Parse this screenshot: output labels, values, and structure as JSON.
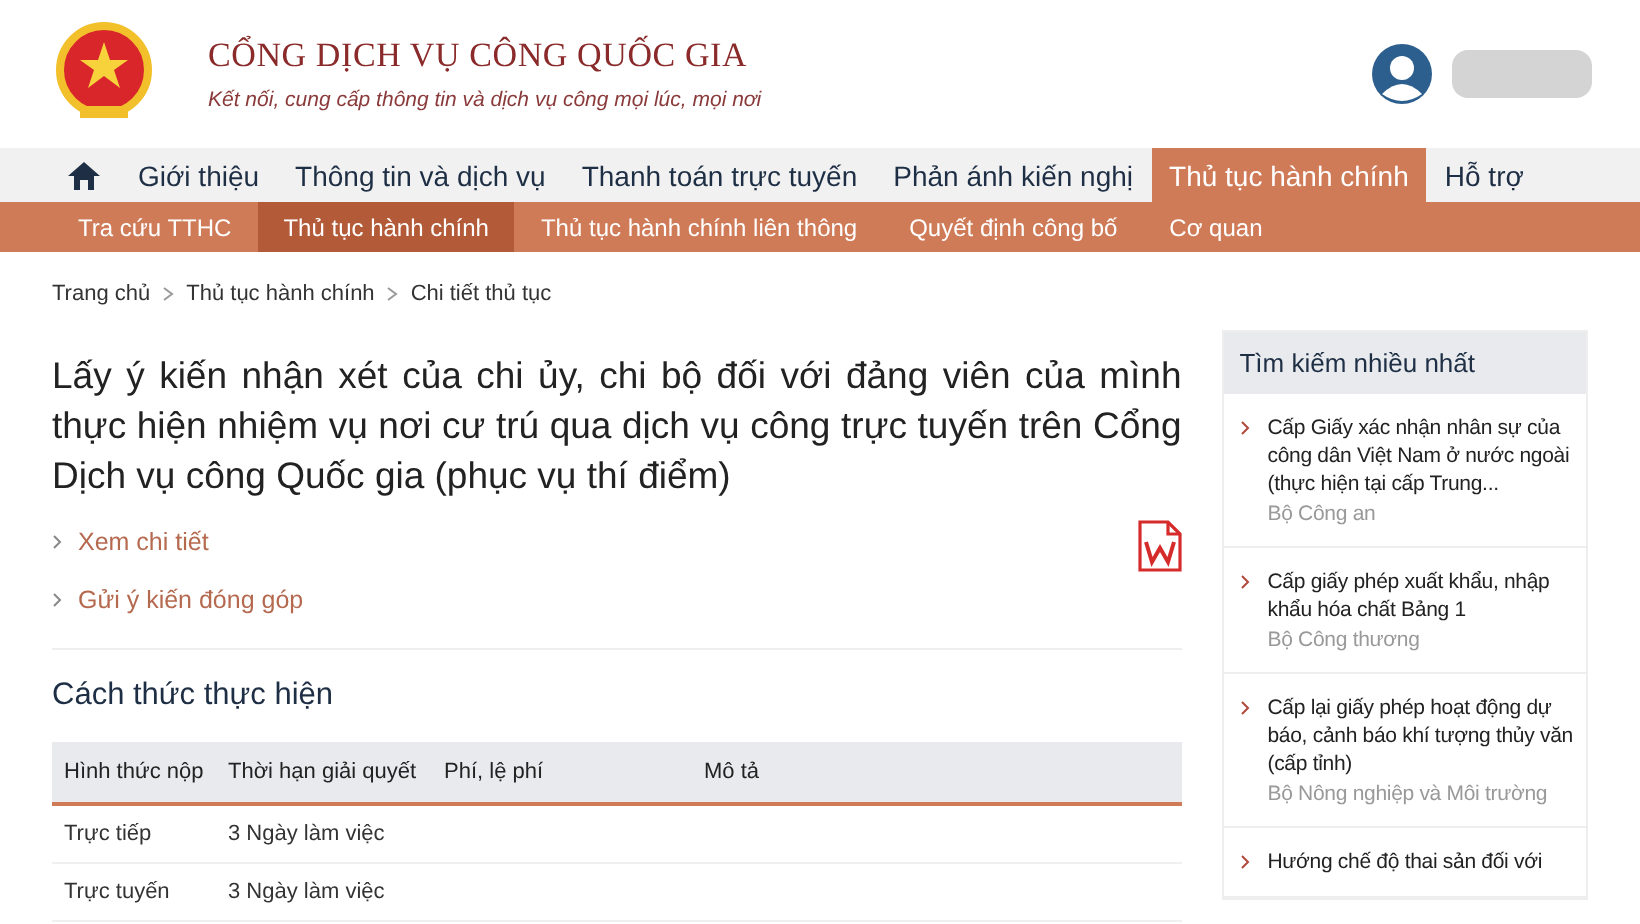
{
  "header": {
    "site_title": "CỔNG DỊCH VỤ CÔNG QUỐC GIA",
    "tagline": "Kết nối, cung cấp thông tin và dịch vụ công mọi lúc, mọi nơi"
  },
  "main_nav": [
    {
      "label": "Giới thiệu",
      "selected": false
    },
    {
      "label": "Thông tin và dịch vụ",
      "selected": false
    },
    {
      "label": "Thanh toán trực tuyến",
      "selected": false
    },
    {
      "label": "Phản ánh kiến nghị",
      "selected": false
    },
    {
      "label": "Thủ tục hành chính",
      "selected": true
    },
    {
      "label": "Hỗ trợ",
      "selected": false
    }
  ],
  "sub_nav": [
    {
      "label": "Tra cứu TTHC",
      "selected": false
    },
    {
      "label": "Thủ tục hành chính",
      "selected": true
    },
    {
      "label": "Thủ tục hành chính liên thông",
      "selected": false
    },
    {
      "label": "Quyết định công bố",
      "selected": false
    },
    {
      "label": "Cơ quan",
      "selected": false
    }
  ],
  "breadcrumb": [
    "Trang chủ",
    "Thủ tục hành chính",
    "Chi tiết thủ tục"
  ],
  "title": "Lấy ý kiến nhận xét của chi ủy, chi bộ đối với đảng viên của mình thực hiện nhiệm vụ nơi cư trú qua dịch vụ công trực tuyến trên Cổng Dịch vụ công Quốc gia (phục vụ thí điểm)",
  "links": [
    "Xem chi tiết",
    "Gửi ý kiến đóng góp"
  ],
  "section_title": "Cách thức thực hiện",
  "table": {
    "columns": [
      "Hình thức nộp",
      "Thời hạn giải quyết",
      "Phí, lệ phí",
      "Mô tả"
    ],
    "rows": [
      [
        "Trực tiếp",
        "3 Ngày làm việc",
        "",
        ""
      ],
      [
        "Trực tuyến",
        "3 Ngày làm việc",
        "",
        ""
      ]
    ]
  },
  "sidebar": {
    "title": "Tìm kiếm nhiều nhất",
    "items": [
      {
        "name": "Cấp Giấy xác nhận nhân sự của công dân Việt Nam ở nước ngoài (thực hiện tại cấp Trung...",
        "agency": "Bộ Công an"
      },
      {
        "name": "Cấp giấy phép xuất khẩu, nhập khẩu hóa chất Bảng 1",
        "agency": "Bộ Công thương"
      },
      {
        "name": "Cấp lại giấy phép hoạt động dự báo, cảnh báo khí tượng thủy văn (cấp tỉnh)",
        "agency": "Bộ Nông nghiệp và Môi trường"
      },
      {
        "name": "Hướng chế độ thai sản đối với"
      }
    ]
  }
}
